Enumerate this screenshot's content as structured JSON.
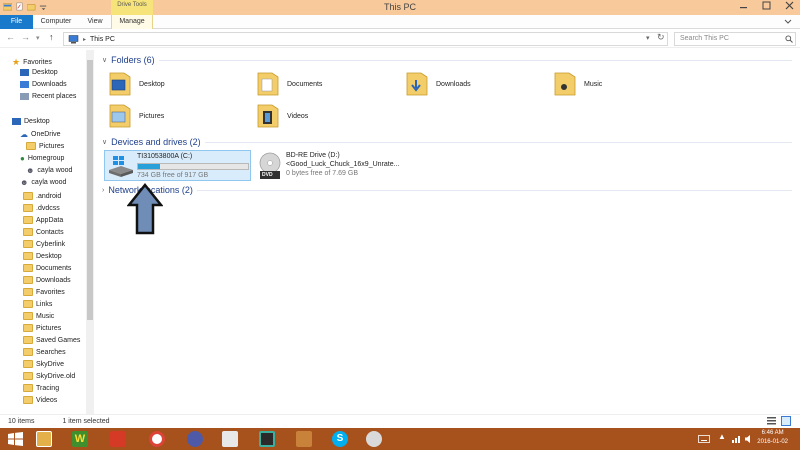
{
  "window": {
    "title": "This PC",
    "context_tab": "Drive Tools"
  },
  "ribbon": {
    "tabs": [
      "File",
      "Computer",
      "View",
      "Manage"
    ]
  },
  "address": {
    "path": "This PC",
    "search_placeholder": "Search This PC"
  },
  "nav": {
    "favorites": {
      "label": "Favorites",
      "items": [
        "Desktop",
        "Downloads",
        "Recent places"
      ]
    },
    "desktop": {
      "label": "Desktop",
      "items": [
        "OneDrive",
        "Pictures",
        "Homegroup",
        "cayla wood",
        "cayla wood"
      ]
    },
    "user_folders": [
      ".android",
      ".dvdcss",
      "AppData",
      "Contacts",
      "Cyberlink",
      "Desktop",
      "Documents",
      "Downloads",
      "Favorites",
      "Links",
      "Music",
      "Pictures",
      "Saved Games",
      "Searches",
      "SkyDrive",
      "SkyDrive.old",
      "Tracing",
      "Videos"
    ]
  },
  "folders_group": {
    "label": "Folders (6)",
    "items": [
      "Desktop",
      "Documents",
      "Downloads",
      "Music",
      "Pictures",
      "Videos"
    ]
  },
  "drives_group": {
    "label": "Devices and drives (2)",
    "drives": [
      {
        "name": "TI31053800A (C:)",
        "free_text": "734 GB free of 917 GB",
        "used_fraction": 0.2
      },
      {
        "name": "BD-RE Drive (D:)",
        "volume": "<Good_Luck_Chuck_16x9_Unrate...",
        "free_text": "0 bytes free of 7.69 GB",
        "disc_label": "DVD"
      }
    ]
  },
  "network_group": {
    "label": "Network locations (2)"
  },
  "status": {
    "items_count": "10 items",
    "selected": "1 item selected"
  },
  "taskbar": {
    "time": "6:46 AM",
    "date": "2016-01-02"
  },
  "colors": {
    "titlebar": "#f8c99a",
    "taskbar": "#a7511c",
    "file_tab": "#1979ca",
    "accent_bar": "#27a0da"
  }
}
